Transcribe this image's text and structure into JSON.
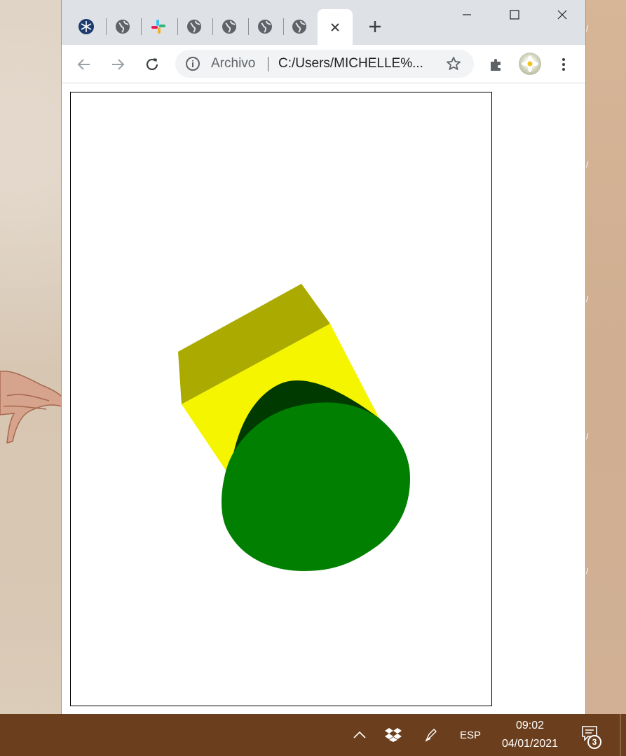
{
  "browser": {
    "tabs": [
      {
        "icon": "snowflake-favicon-icon"
      },
      {
        "icon": "globe-icon"
      },
      {
        "icon": "slack-icon"
      },
      {
        "icon": "globe-icon"
      },
      {
        "icon": "globe-icon"
      },
      {
        "icon": "globe-icon"
      },
      {
        "icon": "globe-icon"
      }
    ],
    "active_tab": {
      "icon": "close-icon"
    },
    "new_tab_icon": "plus-icon",
    "window_controls": [
      "minimize-icon",
      "maximize-icon",
      "close-icon"
    ],
    "toolbar": {
      "back_icon": "back-arrow-icon",
      "forward_icon": "forward-arrow-icon",
      "reload_icon": "reload-icon",
      "extensions_icon": "puzzle-icon",
      "menu_icon": "kebab-menu-icon"
    },
    "omnibox": {
      "scheme_label": "Archivo",
      "url": "C:/Users/MICHELLE%...",
      "info_icon": "info-icon",
      "bookmark_icon": "star-icon"
    }
  },
  "scene": {
    "shapes": [
      "yellow-cube",
      "green-cylinder"
    ],
    "colors": {
      "cube_front": "#f5f500",
      "cube_top": "#aaaa00",
      "cylinder_face": "#007f00",
      "cylinder_side": "#003a00"
    }
  },
  "taskbar": {
    "language": "ESP",
    "time": "09:02",
    "date": "04/01/2021",
    "notification_count": "3",
    "tray_icons": [
      "chevron-up-icon",
      "dropbox-icon",
      "pen-icon"
    ],
    "colors": {
      "background": "#6b3f1d"
    }
  }
}
